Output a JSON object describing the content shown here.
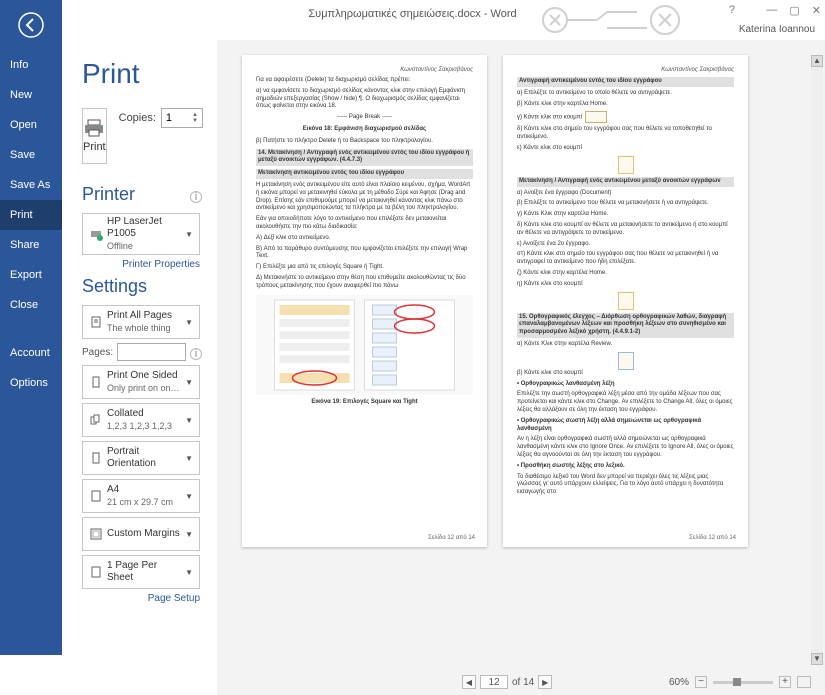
{
  "titlebar": {
    "title": "Συμπληρωματικές σημειώσεις.docx - Word",
    "user": "Katerina Ioannou"
  },
  "sidebar": {
    "items": [
      {
        "label": "Info",
        "key": "info"
      },
      {
        "label": "New",
        "key": "new"
      },
      {
        "label": "Open",
        "key": "open"
      },
      {
        "label": "Save",
        "key": "save"
      },
      {
        "label": "Save As",
        "key": "save-as"
      },
      {
        "label": "Print",
        "key": "print",
        "active": true
      },
      {
        "label": "Share",
        "key": "share"
      },
      {
        "label": "Export",
        "key": "export"
      },
      {
        "label": "Close",
        "key": "close"
      }
    ],
    "footer_items": [
      {
        "label": "Account",
        "key": "account"
      },
      {
        "label": "Options",
        "key": "options"
      }
    ]
  },
  "print": {
    "heading": "Print",
    "button_label": "Print",
    "copies_label": "Copies:",
    "copies_value": "1",
    "printer_heading": "Printer",
    "printer_name": "HP LaserJet P1005",
    "printer_status": "Offline",
    "printer_properties_link": "Printer Properties",
    "settings_heading": "Settings",
    "pages_label": "Pages:",
    "page_setup_link": "Page Setup",
    "dropdowns": {
      "print_range": {
        "title": "Print All Pages",
        "sub": "The whole thing"
      },
      "sides": {
        "title": "Print One Sided",
        "sub": "Only print on one side of th..."
      },
      "collate": {
        "title": "Collated",
        "sub": "1,2,3   1,2,3   1,2,3"
      },
      "orientation": {
        "title": "Portrait Orientation",
        "sub": ""
      },
      "paper": {
        "title": "A4",
        "sub": "21 cm x 29.7 cm"
      },
      "margins": {
        "title": "Custom Margins",
        "sub": ""
      },
      "sheet": {
        "title": "1 Page Per Sheet",
        "sub": ""
      }
    }
  },
  "nav": {
    "current_page": "12",
    "total_pages": "of 14",
    "zoom": "60%"
  },
  "preview": {
    "author": "Κωνσταντίνος Σακρισβάνος",
    "page1": {
      "p1": "Για να αφαιρέσετε (Delete) τα διαχωρισμό σελίδας πρέπει:",
      "p2": "α) να εμφανίσετε το διαχωρισμό σελίδας κάνοντας κλικ στην επιλογή Εμφάνιση σημαδιών επεξεργασίας (Show / hide) ¶. Ο διαχωρισμός σελίδας εμφανίζεται όπως φαίνεται στην εικόνα 18.",
      "pb": "----- Page Break -----",
      "cap1": "Εικόνα 18: Εμφάνιση διαχωρισμού σελίδας",
      "p3": "β) Πατήστε το πλήκτρο Delete ή τo Backspace του πληκτρολογίου.",
      "s1": "14.  Μετακίνηση / Αντιγραφή ενός αντικειμένου εντός του ιδίου εγγράφου ή μεταξύ ανοικτών εγγράφων. (4.4.7.3)",
      "s2": "Μετακίνηση αντικειμένου εντός του ιδίου εγγράφου",
      "p4": "Η μετακίνηση ενός αντικειμένου είτε αυτό είναι πλαίσιο κειμένου, σχήμα, WordArt ή εικόνα μπορεί να μετακινηθεί εύκολα με τη μέθοδο  Σύρε και Άφησε (Drag and Drop). Επίσης εάν επιθυμούμε μπορεί να μετακινηθεί κάνοντας κλικ πάνω στο αντικείμενο και χρησιμοποιώντας τα πλήκτρα με τα βέλη του πληκτρολογίου.",
      "p5": "Εάν για οποιοδήποτε λόγο το αντικείμενο που επιλέξατε δεν μετακινείται ακολουθήστε την πιο κάτω διαδικασία:",
      "p6": "A) Δεξί κλικ στο αντικείμενο.",
      "p7": "B) Από το παράθυρο συντόμευσης που εμφανίζεται επιλέξετε την επιλογή Wrap Text.",
      "p8": "Γ) Επιλέξτε μια από τις επιλογές Square ή Tight.",
      "p9": "Δ) Μετακινήστε το αντικείμενο στην θέση που επιθυμείτε ακολουθώντας τις δύο τρόπους μετακίνησης που έχουν αναφερθεί πιο πάνω",
      "cap2": "Εικόνα 19: Επιλογές Square και Tight",
      "footer": "Σελίδα 12 από 14"
    },
    "page2": {
      "s1": "Αντιγραφή αντικειμένου εντός του ιδίου εγγράφου",
      "p1": "α) Επιλέξτε το αντικείμενο το οποίο θέλετε να αντιγράψετε.",
      "p2": "β) Κάντε κλικ στην καρτέλα Home.",
      "p3": "γ) Κάντε κλικ στο κουμπί",
      "p4": "δ) Κάντε κλικ στο σημείο του εγγράφου σας που θέλετε να τοποθετηθεί το αντικείμενο.",
      "p5": "ε) Κάντε κλικ στο κουμπί",
      "s2": "Μετακίνηση / Αντιγραφή ενός αντικειμένου μεταξύ ανοικτών εγγράφων",
      "p6": "α) Ανοίξτε ένα έγγραφο (Document)",
      "p7": "β) Επιλέξτε το αντικείμενο που θέλετε να μετακινήσετε ή να αντιγράψετε.",
      "p8": "γ) Κάντε Κλικ στην καρτέλα Home.",
      "p9": "δ) Κάντε κλικ στο κουμπί           αν θέλετε να μετακινήσετε το αντικείμενο ή στο κουμπί           αν θέλετε να αντιγράψετε το αντικείμενο.",
      "p10": "ε) Ανοίξετε ένα 2ο έγγραφο.",
      "p11": "στ) Κάντε κλικ στο σημείο του εγγράφου σας που θέλετε να μετακινηθεί ή να αντιγραφεί το αντικείμενο που ήδη επιλέξατε.",
      "p12": "ζ) Κάντε κλικ στην καρτέλα Home.",
      "p13": "η) Κάντε κλικ στο κουμπί",
      "s3": "15. Ορθογραφικός έλεγχος – Διόρθωση ορθογραφικών λαθών, διαγραφή επαναλαμβανομένων λέξεων και προσθήκη λέξεων στο συνηθισμένο και προσαρμοσμένο λεξικό χρήστη. (4.4.9.1-2)",
      "p14": "α) Κάντε Κλικ στην καρτέλα Review.",
      "p15": "β) Κάντε κλικ στο κουμπί",
      "s4": "• Ορθογραφικώς λανθασμένη λέξη",
      "p16": "Επιλέξτε την σωστή ορθογραφικά λέξη μέσα από την ομάδα λέξεων που σας προτείνεται και κάντε κλικ στο Change. Αν επιλέξετε το Change All, όλες οι όμοιες λέξεις θα αλλάξουν σε όλη την έκταση του εγγράφου.",
      "s5": "• Ορθογραφικώς σωστή λέξη αλλά σημειώνεται ως ορθογραφικά λανθασμένη",
      "p17": "Αν η λέξη είναι ορθογραφικά σωστή αλλά σημειώνεται ως ορθογραφικά λανθασμένη κάντε κλικ στο Ignore Once. Αν επιλέξετε τo Ignore All, όλες οι όμοιες λέξεις θα αγνοούνται σε όλη την έκταση του εγγράφου.",
      "s6": "• Προσθήκη σωστής λέξης στο λεξικό.",
      "p18": "Το διαθέσιμο λεξικό του Word δεν μπορεί να περιέχει όλες τις λέξεις μιας γλώσσας γι' αυτό υπάρχουν ελλείψεις. Για το λόγο αυτό υπάρχει η δυνατότητα εισαγωγής στο",
      "footer": "Σελίδα 12 από 14"
    }
  }
}
